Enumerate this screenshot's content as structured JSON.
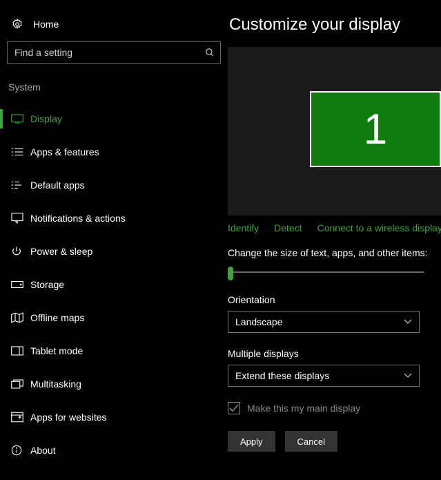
{
  "home_label": "Home",
  "search": {
    "placeholder": "Find a setting"
  },
  "section_title": "System",
  "nav": [
    {
      "label": "Display",
      "active": true
    },
    {
      "label": "Apps & features"
    },
    {
      "label": "Default apps"
    },
    {
      "label": "Notifications & actions"
    },
    {
      "label": "Power & sleep"
    },
    {
      "label": "Storage"
    },
    {
      "label": "Offline maps"
    },
    {
      "label": "Tablet mode"
    },
    {
      "label": "Multitasking"
    },
    {
      "label": "Apps for websites"
    },
    {
      "label": "About"
    }
  ],
  "page_title": "Customize your display",
  "monitor": {
    "number": "1"
  },
  "links": {
    "identify": "Identify",
    "detect": "Detect",
    "wireless": "Connect to a wireless display"
  },
  "scale_label": "Change the size of text, apps, and other items:",
  "orientation": {
    "label": "Orientation",
    "value": "Landscape"
  },
  "multiple": {
    "label": "Multiple displays",
    "value": "Extend these displays"
  },
  "main_display_label": "Make this my main display",
  "buttons": {
    "apply": "Apply",
    "cancel": "Cancel"
  }
}
